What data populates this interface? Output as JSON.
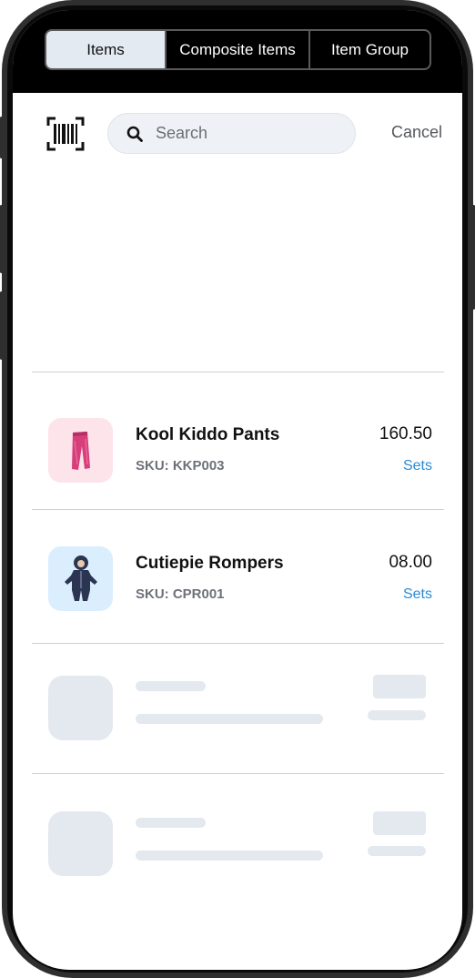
{
  "tabs": [
    {
      "label": "Items",
      "active": true
    },
    {
      "label": "Composite Items",
      "active": false
    },
    {
      "label": "Item Group",
      "active": false
    }
  ],
  "search": {
    "placeholder": "Search",
    "value": "",
    "cancel_label": "Cancel"
  },
  "items": [
    {
      "name": "Kool Kiddo Pants",
      "sku": "SKU: KKP003",
      "price": "160.50",
      "unit": "Sets",
      "thumb_bg": "#fde3ea",
      "icon": "pink-pants-icon"
    },
    {
      "name": "Cutiepie Rompers",
      "sku": "SKU: CPR001",
      "price": "08.00",
      "unit": "Sets",
      "thumb_bg": "#dbeefe",
      "icon": "navy-romper-icon"
    }
  ],
  "colors": {
    "accent": "#2a8bd6",
    "skeleton": "#e4e9f0",
    "active_tab_bg": "#e4eaf2"
  }
}
